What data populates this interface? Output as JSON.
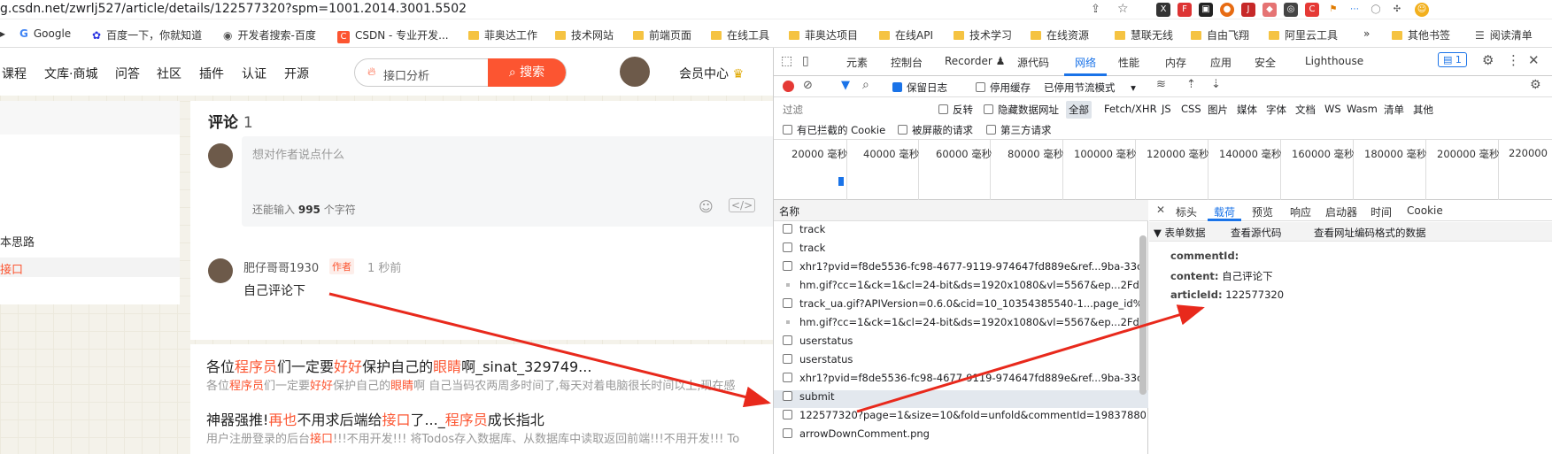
{
  "browser": {
    "url": "g.csdn.net/zwrlj527/article/details/122577320?spm=1001.2014.3001.5502",
    "bookmarks": [
      "Google",
      "百度一下，你就知道",
      "开发者搜索-百度",
      "CSDN - 专业开发...",
      "菲奥达工作",
      "技术网站",
      "前端页面",
      "在线工具",
      "菲奥达项目",
      "在线API",
      "技术学习",
      "在线资源",
      "慧联无线",
      "自由飞翔",
      "阿里云工具",
      "»",
      "其他书签",
      "阅读清单"
    ]
  },
  "site": {
    "nav": [
      "课程",
      "文库·商城",
      "问答",
      "社区",
      "插件",
      "认证",
      "开源"
    ],
    "search_placeholder": "接口分析",
    "search_button": "搜索",
    "member_center": "会员中心",
    "sidebar": [
      "本思路",
      "接口"
    ]
  },
  "comments": {
    "title": "评论",
    "count": "1",
    "input_placeholder": "想对作者说点什么",
    "remaining_prefix": "还能输入",
    "remaining_count": "995",
    "remaining_suffix": "个字符",
    "item": {
      "user": "肥仔哥哥1930",
      "badge": "作者",
      "time": "1 秒前",
      "text": "自己评论下"
    }
  },
  "related": [
    {
      "t1": "各位",
      "r1": "程序员",
      "t2": "们一定要",
      "r2": "好好",
      "t3": "保护自己的",
      "r3": "眼睛",
      "t4": "啊_sinat_329749...",
      "d1": "各位",
      "dr1": "程序员",
      "d2": "们一定要",
      "dr2": "好好",
      "d3": "保护自己的",
      "dr3": "眼睛",
      "d4": "啊 自己当码农两周多时间了,每天对着电脑很长时间以上,现在感"
    },
    {
      "t1": "神器强推!",
      "r1": "再也",
      "t2": "不用求后端给",
      "r2": "接口",
      "t3": "了..._",
      "r3": "程序员",
      "t4": "成长指北",
      "d1": "用户注册登录的后台",
      "dr1": "接口",
      "d2": "!!!不用开发!!! 将Todos存入数据库、从数据库中读取返回前端!!!不用开发!!! To",
      "dr2": "",
      "d3": "",
      "dr3": "",
      "d4": ""
    }
  ],
  "devtools": {
    "tabs": [
      "元素",
      "控制台",
      "Recorder",
      "源代码",
      "网络",
      "性能",
      "内存",
      "应用",
      "安全",
      "Lighthouse"
    ],
    "active_tab": "网络",
    "issues_count": "1",
    "toolbar": {
      "preserve_log": "保留日志",
      "disable_cache": "停用缓存",
      "throttle": "已停用节流模式"
    },
    "filter": {
      "placeholder": "过滤",
      "invert": "反转",
      "hide_data_urls": "隐藏数据网址",
      "types": [
        "全部",
        "Fetch/XHR",
        "JS",
        "CSS",
        "图片",
        "媒体",
        "字体",
        "文档",
        "WS",
        "Wasm",
        "清单",
        "其他"
      ],
      "blocked_cookies": "有已拦截的 Cookie",
      "blocked_requests": "被屏蔽的请求",
      "third_party": "第三方请求"
    },
    "timeline_ticks": [
      "20000 毫秒",
      "40000 毫秒",
      "60000 毫秒",
      "80000 毫秒",
      "100000 毫秒",
      "120000 毫秒",
      "140000 毫秒",
      "160000 毫秒",
      "180000 毫秒",
      "200000 毫秒",
      "220000"
    ],
    "name_header": "名称",
    "requests": [
      "track",
      "track",
      "xhr1?pvid=f8de5536-fc98-4677-9119-974647fd889e&ref...9ba-33c0-45f5-adc8",
      "hm.gif?cc=1&ck=1&cl=24-bit&ds=1920x1080&vl=5567&ep...2Fdetails%2F122",
      "track_ua.gif?APIVersion=0.6.0&cid=10_10354385540-1...page_id%3Ddefault%",
      "hm.gif?cc=1&ck=1&cl=24-bit&ds=1920x1080&vl=5567&ep...2Fdetails%2F122",
      "userstatus",
      "userstatus",
      "xhr1?pvid=f8de5536-fc98-4677-9119-974647fd889e&ref...9ba-33c0-45f5-adc8",
      "submit",
      "122577320?page=1&size=10&fold=unfold&commentId=19837880",
      "arrowDownComment.png"
    ],
    "selected_request": "submit",
    "detail_tabs": [
      "标头",
      "载荷",
      "预览",
      "响应",
      "启动器",
      "时间",
      "Cookie"
    ],
    "active_detail_tab": "载荷",
    "form_section": "▼ 表单数据",
    "view_source": "查看源代码",
    "view_encoded": "查看网址编码格式的数据",
    "payload": [
      {
        "key": "commentId:",
        "value": ""
      },
      {
        "key": "content:",
        "value": "自己评论下"
      },
      {
        "key": "articleId:",
        "value": "122577320"
      }
    ]
  },
  "colors": {
    "accent": "#fc5531",
    "devtools_blue": "#1a73e8",
    "arrow_red": "#e8291c"
  }
}
